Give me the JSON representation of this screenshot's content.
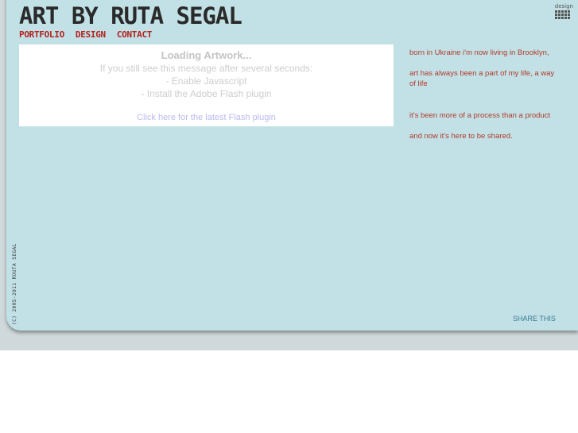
{
  "header": {
    "title": "ART BY RUTA SEGAL",
    "nav": [
      "PORTFOLIO",
      "DESIGN",
      "CONTACT"
    ],
    "design_logo_label": "design"
  },
  "flash_box": {
    "loading": "Loading Artwork...",
    "message": "If you still see this message after several seconds:",
    "step_1": "- Enable Javascript",
    "step_2": "- Install the Adobe Flash plugin",
    "link": "Click here for the latest Flash plugin"
  },
  "about": {
    "line_1": "born in Ukraine i'm now living in Brooklyn,",
    "line_2": "art has always been a part of my life, a way of life",
    "line_3": "it's been more of a process than a product",
    "line_4": "and now it's here to be shared."
  },
  "footer": {
    "share": "SHARE THIS",
    "copyright": "(C) 2005-2011 ROUTA SEGAL"
  },
  "colors": {
    "panel": "#c1e1e6",
    "nav_red": "#b4201c",
    "body_text_red": "#b33a2a",
    "share_blue": "#3b7a92"
  }
}
